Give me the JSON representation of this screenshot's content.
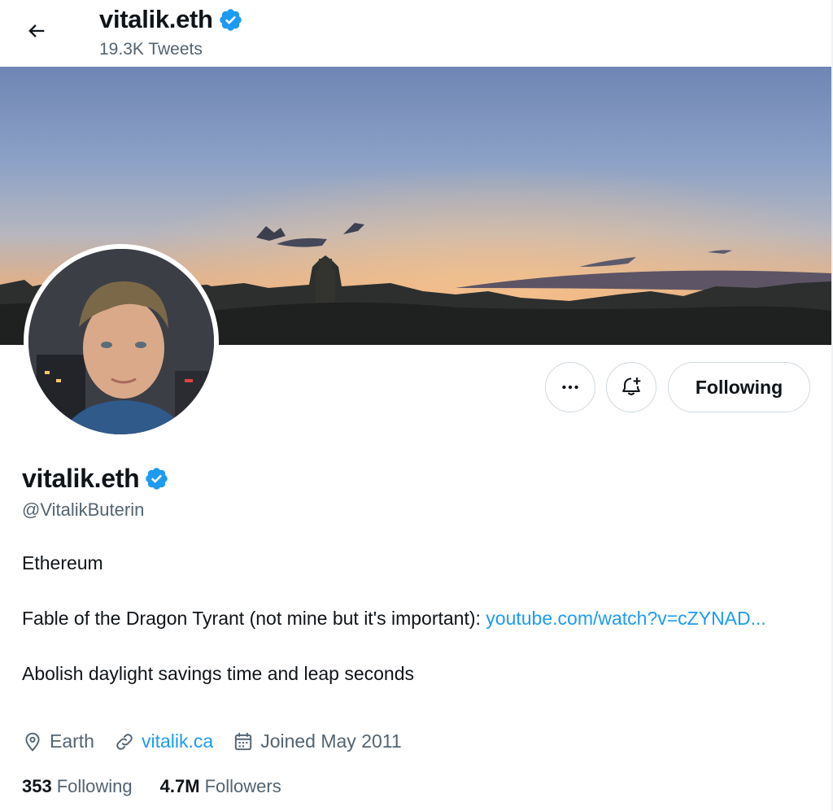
{
  "header": {
    "name": "vitalik.eth",
    "tweet_count": "19.3K Tweets"
  },
  "profile": {
    "display_name": "vitalik.eth",
    "handle": "@VitalikButerin",
    "verified": true
  },
  "actions": {
    "more_label": "···",
    "following_label": "Following"
  },
  "bio": {
    "line1": "Ethereum",
    "line2_text": "Fable of the Dragon Tyrant (not mine but it's important): ",
    "line2_link": "youtube.com/watch?v=cZYNAD...",
    "line3": "Abolish daylight savings time and leap seconds"
  },
  "meta": {
    "location": "Earth",
    "website": "vitalik.ca",
    "joined": "Joined May 2011"
  },
  "stats": {
    "following_count": "353",
    "following_label": "Following",
    "followers_count": "4.7M",
    "followers_label": "Followers"
  },
  "colors": {
    "accent": "#1d9bf0",
    "text": "#0f1419",
    "secondary": "#536471",
    "border": "#cfd9de"
  },
  "icons": {
    "back": "arrow-left-icon",
    "verified": "verified-badge-icon",
    "more": "more-icon",
    "notify": "bell-plus-icon",
    "location": "location-pin-icon",
    "link": "link-icon",
    "calendar": "calendar-icon"
  }
}
